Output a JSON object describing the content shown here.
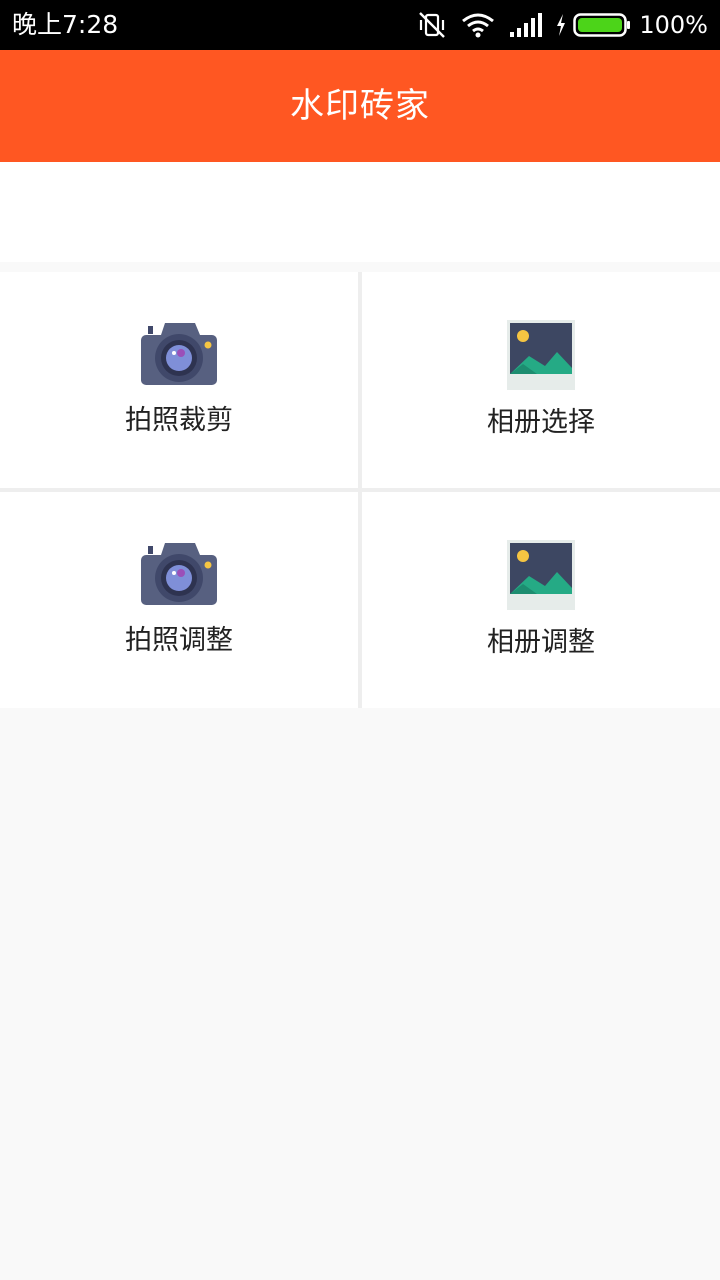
{
  "status_bar": {
    "time": "晚上7:28",
    "battery": "100%",
    "icons": [
      "vibrate-off-icon",
      "wifi-icon",
      "signal-icon",
      "charging-icon",
      "battery-icon"
    ],
    "battery_color": "#4cd419"
  },
  "app_bar": {
    "title": "水印砖家",
    "color": "#ff5722"
  },
  "grid": {
    "items": [
      {
        "label": "拍照裁剪",
        "icon": "camera-icon"
      },
      {
        "label": "相册选择",
        "icon": "picture-icon"
      },
      {
        "label": "拍照调整",
        "icon": "camera-icon"
      },
      {
        "label": "相册调整",
        "icon": "picture-icon"
      }
    ]
  }
}
